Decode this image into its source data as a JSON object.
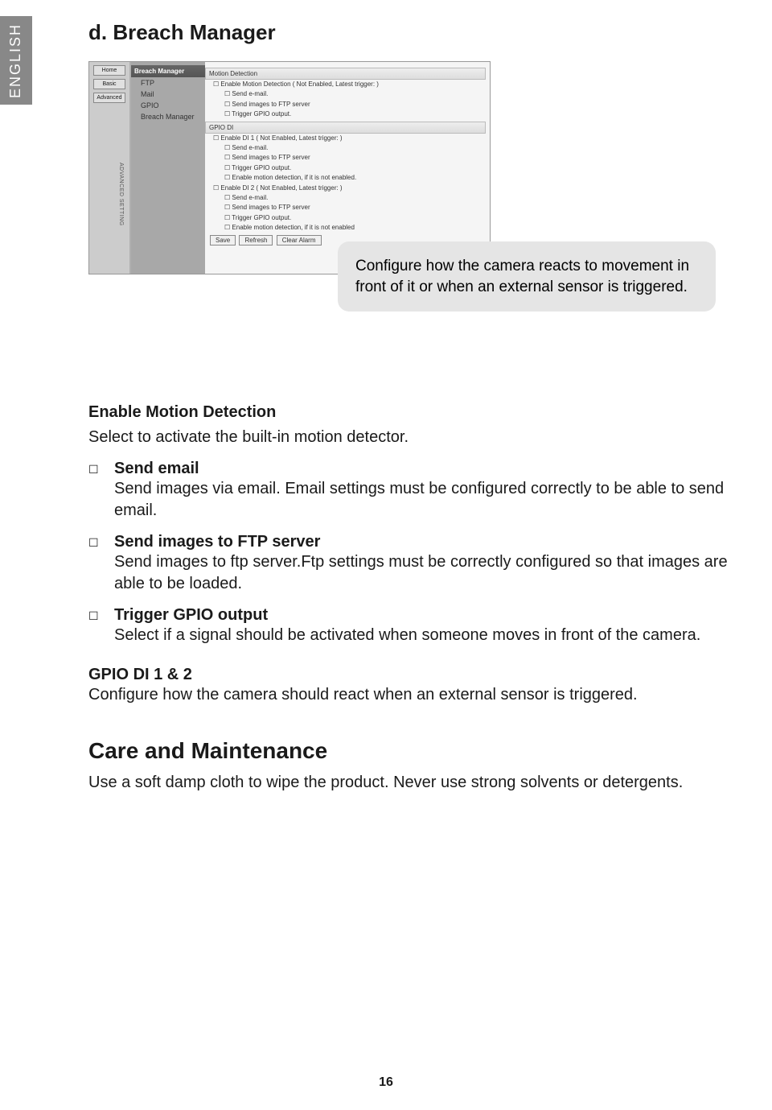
{
  "language_tab": "ENGLISH",
  "section_title": "d. Breach Manager",
  "screenshot": {
    "sidebar_buttons": [
      "Home",
      "Basic",
      "Advanced"
    ],
    "vertical_label": "ADVANCED SETTING",
    "tree": {
      "header": "Breach Manager",
      "items": [
        "FTP",
        "Mail",
        "GPIO",
        "Breach Manager"
      ]
    },
    "main": {
      "section1_hdr": "Motion Detection",
      "section1_lines": [
        "Enable Motion Detection   ( Not Enabled, Latest trigger: )",
        "Send e-mail.",
        "Send images to FTP server",
        "Trigger GPIO output."
      ],
      "section2_hdr": "GPIO DI",
      "section2_lines": [
        "Enable DI 1   ( Not Enabled, Latest trigger: )",
        "Send e-mail.",
        "Send images to FTP server",
        "Trigger GPIO output.",
        "Enable motion detection, if it is not enabled.",
        "Enable DI 2   ( Not Enabled, Latest trigger: )",
        "Send e-mail.",
        "Send images to FTP server",
        "Trigger GPIO output.",
        "Enable motion detection, if it is not enabled"
      ],
      "buttons": [
        "Save",
        "Refresh",
        "Clear Alarm"
      ]
    }
  },
  "callout_text": "Configure how the camera reacts to movement in front of it or when an external sensor is triggered.",
  "enable_heading": "Enable Motion Detection",
  "enable_text": "Select to activate the built-in motion detector.",
  "bullets": [
    {
      "title": "Send email",
      "text": "Send images via email. Email settings must be configured correctly to be able to send email."
    },
    {
      "title": "Send images to FTP server",
      "text": "Send images to ftp server.Ftp settings must be correctly configured so that images are able to be loaded."
    },
    {
      "title": "Trigger GPIO output",
      "text": "Select if a signal should be activated when someone moves in front of the camera."
    }
  ],
  "gpio_heading": "GPIO DI 1 & 2",
  "gpio_text": "Configure how the camera should react when an external sensor is triggered.",
  "care_heading": "Care and Maintenance",
  "care_text": "Use a soft damp cloth to wipe the product. Never use strong solvents or detergents.",
  "page_number": "16"
}
